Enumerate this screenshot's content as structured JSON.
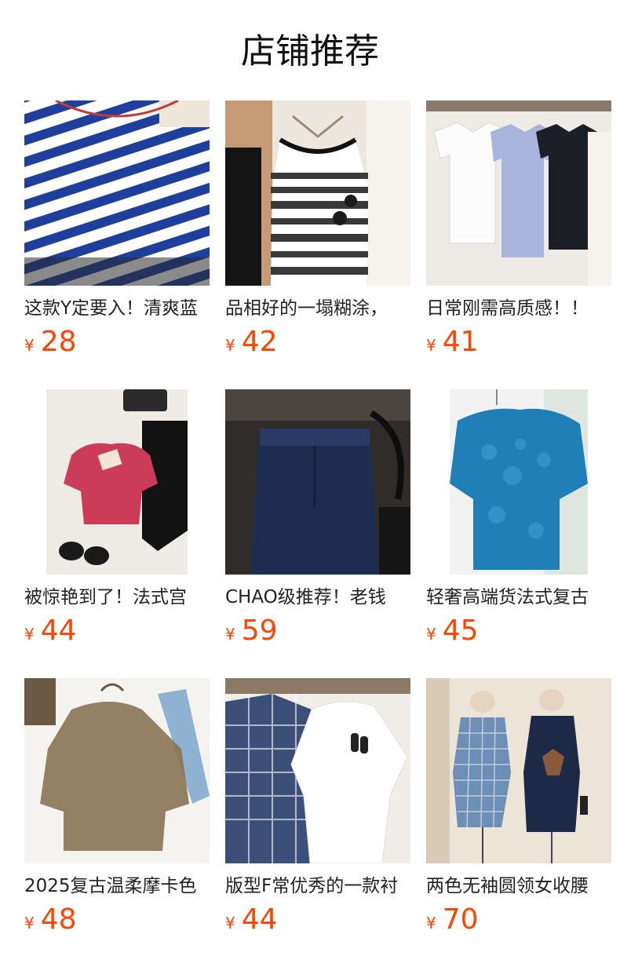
{
  "section": {
    "title": "店铺推荐"
  },
  "currency": "¥",
  "products": [
    {
      "name": "这款Y定要入！清爽蓝",
      "price": "28"
    },
    {
      "name": "品相好的一塌糊涂，",
      "price": "42"
    },
    {
      "name": "日常刚需高质感！！",
      "price": "41"
    },
    {
      "name": "被惊艳到了！法式宫",
      "price": "44"
    },
    {
      "name": "CHAO级推荐！老钱",
      "price": "59"
    },
    {
      "name": "轻奢高端货法式复古",
      "price": "45"
    },
    {
      "name": "2025复古温柔摩卡色",
      "price": "48"
    },
    {
      "name": "版型F常优秀的一款衬",
      "price": "44"
    },
    {
      "name": "两色无袖圆领女收腰",
      "price": "70"
    }
  ],
  "colors": {
    "price": "#ff4400",
    "title": "#111111",
    "text": "#222222"
  }
}
